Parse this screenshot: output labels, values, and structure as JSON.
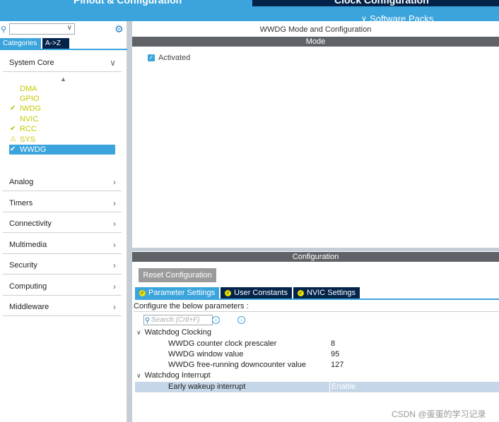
{
  "header": {
    "tab_pinout": "Pinout & Configuration",
    "tab_clock": "Clock Configuration",
    "software_packs": "Software Packs"
  },
  "sidebar": {
    "category_tabs": [
      "Categories",
      "A->Z"
    ],
    "system_core": {
      "label": "System Core",
      "items": [
        {
          "label": "DMA",
          "icon": "none"
        },
        {
          "label": "GPIO",
          "icon": "none"
        },
        {
          "label": "IWDG",
          "icon": "check"
        },
        {
          "label": "NVIC",
          "icon": "none"
        },
        {
          "label": "RCC",
          "icon": "check"
        },
        {
          "label": "SYS",
          "icon": "warning"
        },
        {
          "label": "WWDG",
          "icon": "check",
          "selected": true
        }
      ]
    },
    "sections": [
      "Analog",
      "Timers",
      "Connectivity",
      "Multimedia",
      "Security",
      "Computing",
      "Middleware"
    ]
  },
  "main": {
    "title": "WWDG Mode and Configuration",
    "mode_header": "Mode",
    "activated_label": "Activated",
    "activated_checked": true,
    "config_header": "Configuration",
    "reset_button": "Reset Configuration",
    "param_tabs": [
      "Parameter Settings",
      "User Constants",
      "NVIC Settings"
    ],
    "params_title": "Configure the below parameters :",
    "search_placeholder": "Search (Crtl+F)",
    "groups": [
      {
        "label": "Watchdog Clocking",
        "params": [
          {
            "name": "WWDG counter clock prescaler",
            "value": "8"
          },
          {
            "name": "WWDG window value",
            "value": "95"
          },
          {
            "name": "WWDG free-running downcounter value",
            "value": "127"
          }
        ]
      },
      {
        "label": "Watchdog Interrupt",
        "params": [
          {
            "name": "Early wakeup interrupt",
            "value": "Enable",
            "selected": true
          }
        ]
      }
    ]
  },
  "watermark": "CSDN @蛋蛋的学习记录",
  "colors": {
    "accent": "#3ba4dc",
    "dark_navy": "#03234b",
    "bar_gray": "#5f6368",
    "core_item_text": "#c5c800"
  }
}
